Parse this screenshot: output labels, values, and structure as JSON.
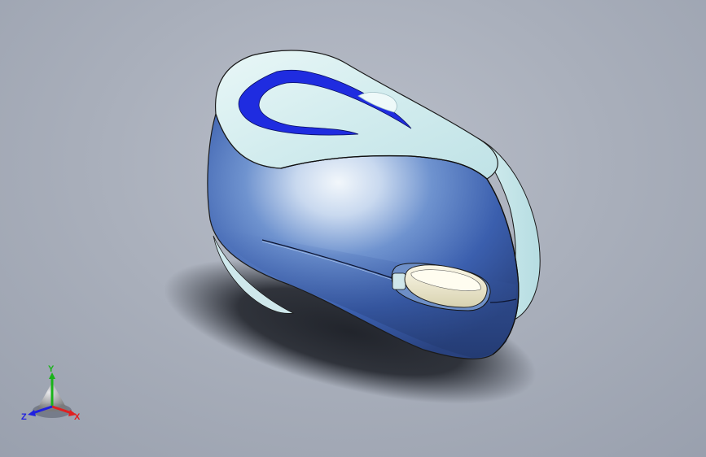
{
  "view": {
    "background_top": "#b9bec9",
    "background_bottom": "#979eac"
  },
  "model": {
    "name": "computer mouse",
    "body_color": "#3f64b6",
    "shell_color": "#d6eef0",
    "logo_color": "#1f2ce0",
    "wheel_color": "#ece8cf"
  },
  "triad": {
    "y_label": "Y",
    "x_label": "X",
    "z_label": "Z",
    "y_color": "#19b319",
    "x_color": "#e02020",
    "z_color": "#2020e0"
  }
}
